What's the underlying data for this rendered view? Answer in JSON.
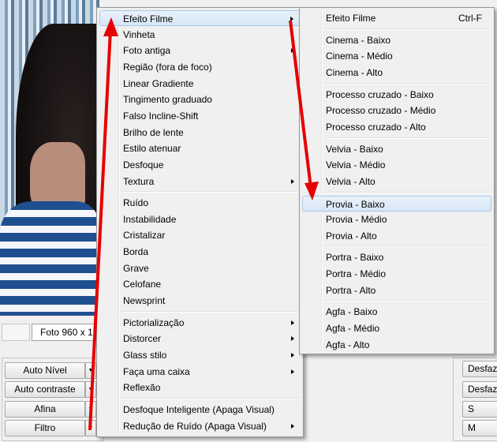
{
  "photo_info": "Foto 960 x 1",
  "left_buttons": [
    "Auto Nível",
    "Auto contraste",
    "Afina",
    "Filtro"
  ],
  "right_buttons": [
    "Desfaze",
    "Desfaz",
    "S",
    "M"
  ],
  "main_menu": [
    {
      "label": "Efeito Filme",
      "submenu": true,
      "highlighted": true
    },
    {
      "label": "Vinheta"
    },
    {
      "label": "Foto antiga",
      "submenu": true
    },
    {
      "label": "Região (fora de foco)"
    },
    {
      "label": "Linear Gradiente"
    },
    {
      "label": "Tingimento graduado"
    },
    {
      "label": "Falso Incline-Shift"
    },
    {
      "label": "Brilho de lente"
    },
    {
      "label": "Estilo atenuar"
    },
    {
      "label": "Desfoque"
    },
    {
      "label": "Textura",
      "submenu": true
    },
    {
      "separator": true
    },
    {
      "label": "Ruído"
    },
    {
      "label": "Instabilidade"
    },
    {
      "label": "Cristalizar"
    },
    {
      "label": "Borda"
    },
    {
      "label": "Grave"
    },
    {
      "label": "Celofane"
    },
    {
      "label": "Newsprint"
    },
    {
      "separator": true
    },
    {
      "label": "Pictorialização",
      "submenu": true
    },
    {
      "label": "Distorcer",
      "submenu": true
    },
    {
      "label": "Glass stilo",
      "submenu": true
    },
    {
      "label": "Faça uma caixa",
      "submenu": true
    },
    {
      "label": "Reflexão"
    },
    {
      "separator": true
    },
    {
      "label": "Desfoque Inteligente (Apaga Visual)"
    },
    {
      "label": "Redução de Ruído (Apaga Visual)",
      "submenu": true
    }
  ],
  "sub_menu": [
    {
      "label": "Efeito Filme",
      "shortcut": "Ctrl-F"
    },
    {
      "separator": true
    },
    {
      "label": "Cinema - Baixo"
    },
    {
      "label": "Cinema - Médio"
    },
    {
      "label": "Cinema - Alto"
    },
    {
      "separator": true
    },
    {
      "label": "Processo cruzado - Baixo"
    },
    {
      "label": "Processo cruzado - Médio"
    },
    {
      "label": "Processo cruzado - Alto"
    },
    {
      "separator": true
    },
    {
      "label": "Velvia - Baixo"
    },
    {
      "label": "Velvia - Médio"
    },
    {
      "label": "Velvia - Alto"
    },
    {
      "separator": true
    },
    {
      "label": "Provia - Baixo",
      "highlighted": true
    },
    {
      "label": "Provia - Médio"
    },
    {
      "label": "Provia - Alto"
    },
    {
      "separator": true
    },
    {
      "label": "Portra - Baixo"
    },
    {
      "label": "Portra - Médio"
    },
    {
      "label": "Portra - Alto"
    },
    {
      "separator": true
    },
    {
      "label": "Agfa - Baixo"
    },
    {
      "label": "Agfa - Médio"
    },
    {
      "label": "Agfa - Alto"
    }
  ],
  "colors": {
    "annotation_arrow": "#e60000",
    "highlight": "#d6e6f7",
    "menu_bg": "#f0f0f0"
  }
}
